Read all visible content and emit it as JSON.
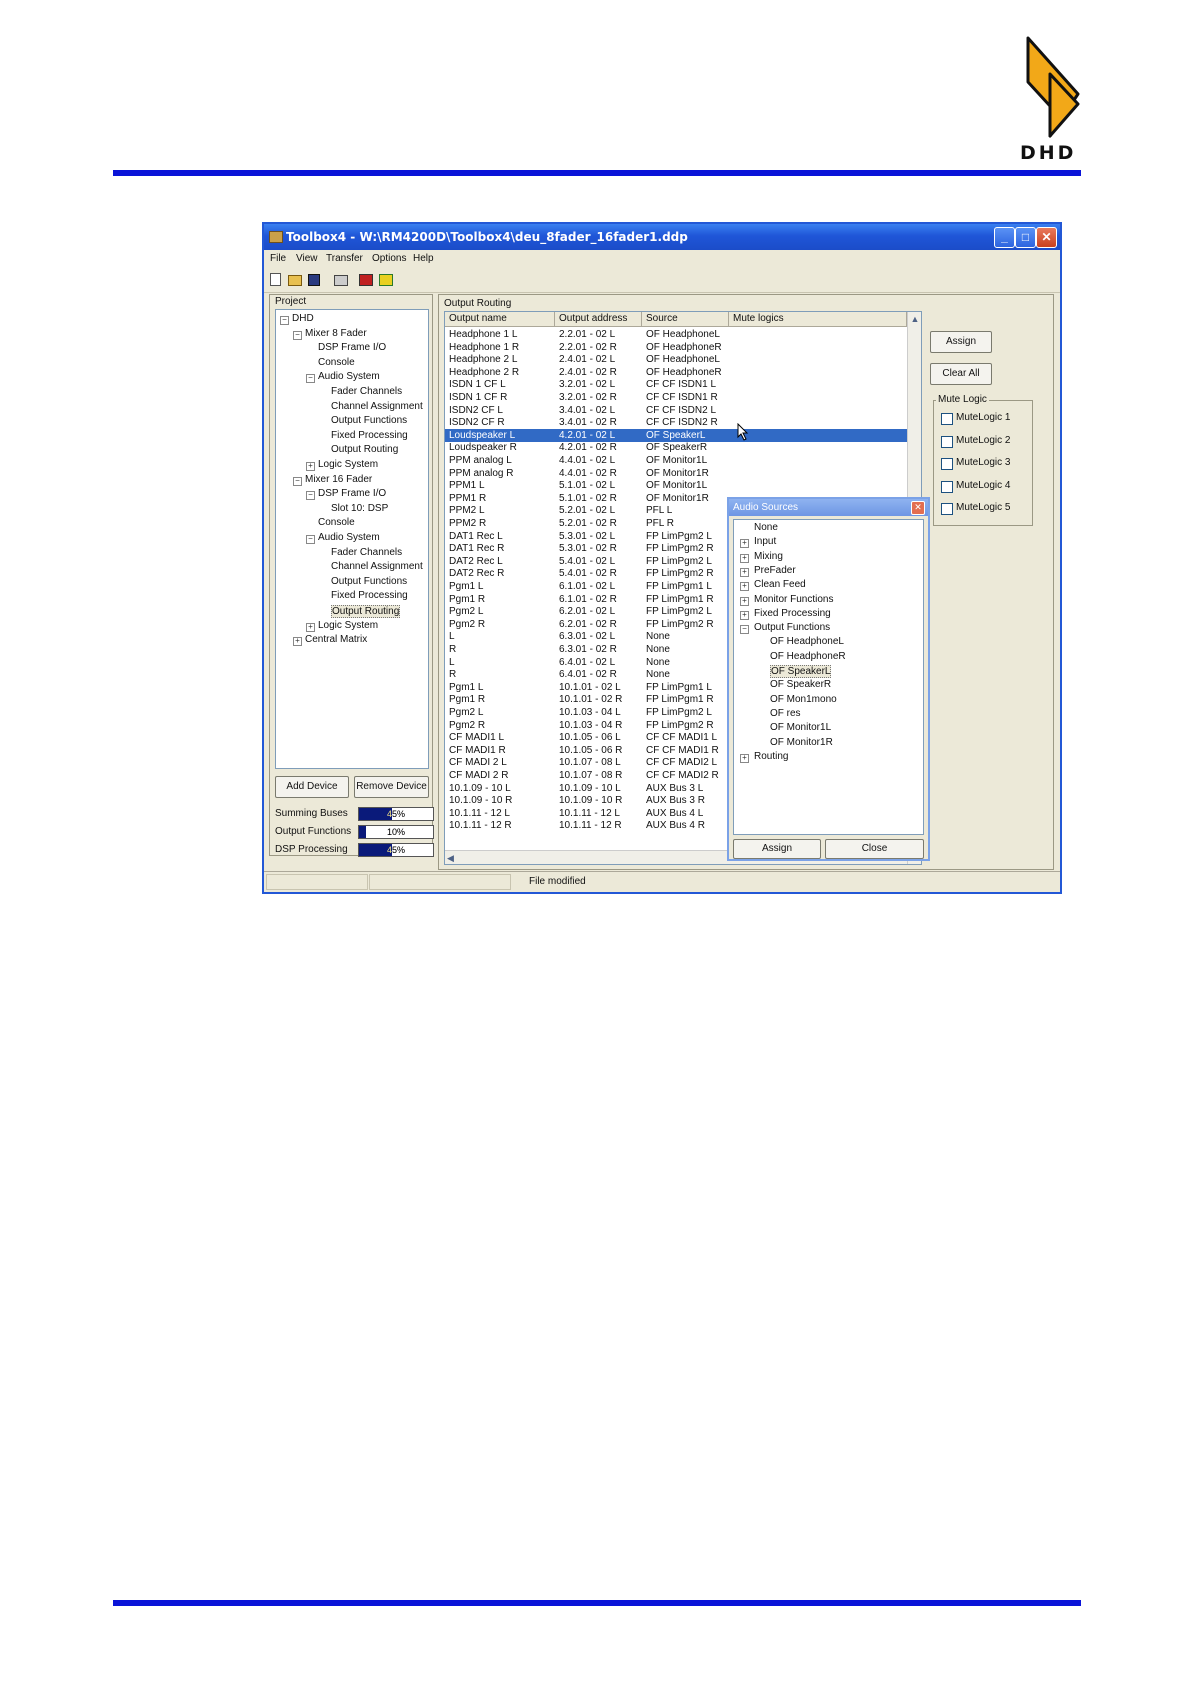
{
  "logo": {
    "text": "DHD"
  },
  "window": {
    "title": "Toolbox4 - W:\\RM4200D\\Toolbox4\\deu_8fader_16fader1.ddp",
    "menu": [
      "File",
      "View",
      "Transfer",
      "Options",
      "Help"
    ],
    "status_text": "File modified"
  },
  "project": {
    "label": "Project",
    "tree": [
      {
        "text": "DHD",
        "level": 0,
        "exp": "-"
      },
      {
        "text": "Mixer 8 Fader",
        "level": 1,
        "exp": "-"
      },
      {
        "text": "DSP Frame I/O",
        "level": 2,
        "exp": ""
      },
      {
        "text": "Console",
        "level": 2,
        "exp": ""
      },
      {
        "text": "Audio System",
        "level": 2,
        "exp": "-"
      },
      {
        "text": "Fader Channels",
        "level": 3,
        "exp": ""
      },
      {
        "text": "Channel Assignment",
        "level": 3,
        "exp": ""
      },
      {
        "text": "Output Functions",
        "level": 3,
        "exp": ""
      },
      {
        "text": "Fixed Processing",
        "level": 3,
        "exp": ""
      },
      {
        "text": "Output Routing",
        "level": 3,
        "exp": ""
      },
      {
        "text": "Logic System",
        "level": 2,
        "exp": "+"
      },
      {
        "text": "Mixer 16 Fader",
        "level": 1,
        "exp": "-"
      },
      {
        "text": "DSP Frame I/O",
        "level": 2,
        "exp": "-"
      },
      {
        "text": "Slot 10: DSP",
        "level": 3,
        "exp": ""
      },
      {
        "text": "Console",
        "level": 2,
        "exp": ""
      },
      {
        "text": "Audio System",
        "level": 2,
        "exp": "-"
      },
      {
        "text": "Fader Channels",
        "level": 3,
        "exp": ""
      },
      {
        "text": "Channel Assignment",
        "level": 3,
        "exp": ""
      },
      {
        "text": "Output Functions",
        "level": 3,
        "exp": ""
      },
      {
        "text": "Fixed Processing",
        "level": 3,
        "exp": ""
      },
      {
        "text": "Output Routing",
        "level": 3,
        "exp": "",
        "selected": true
      },
      {
        "text": "Logic System",
        "level": 2,
        "exp": "+"
      },
      {
        "text": "Central Matrix",
        "level": 1,
        "exp": "+"
      }
    ],
    "add_device": "Add Device",
    "remove_device": "Remove Device",
    "resources": [
      {
        "label": "Summing Buses",
        "percent": 45,
        "text": "45%"
      },
      {
        "label": "Output Functions",
        "percent": 10,
        "text": "10%"
      },
      {
        "label": "DSP Processing",
        "percent": 45,
        "text": "45%"
      }
    ]
  },
  "routing": {
    "label": "Output Routing",
    "columns": [
      "Output name",
      "Output address",
      "Source",
      "Mute logics"
    ],
    "selected_index": 8,
    "rows": [
      [
        "Headphone 1 L",
        "2.2.01 - 02 L",
        "OF HeadphoneL"
      ],
      [
        "Headphone 1 R",
        "2.2.01 - 02 R",
        "OF HeadphoneR"
      ],
      [
        "Headphone 2 L",
        "2.4.01 - 02 L",
        "OF HeadphoneL"
      ],
      [
        "Headphone 2 R",
        "2.4.01 - 02 R",
        "OF HeadphoneR"
      ],
      [
        "ISDN 1 CF L",
        "3.2.01 - 02 L",
        "CF CF ISDN1 L"
      ],
      [
        "ISDN 1 CF R",
        "3.2.01 - 02 R",
        "CF CF ISDN1 R"
      ],
      [
        "ISDN2 CF L",
        "3.4.01 - 02 L",
        "CF CF ISDN2 L"
      ],
      [
        "ISDN2 CF R",
        "3.4.01 - 02 R",
        "CF CF ISDN2 R"
      ],
      [
        "Loudspeaker L",
        "4.2.01 - 02 L",
        "OF SpeakerL"
      ],
      [
        "Loudspeaker R",
        "4.2.01 - 02 R",
        "OF SpeakerR"
      ],
      [
        "PPM analog L",
        "4.4.01 - 02 L",
        "OF Monitor1L"
      ],
      [
        "PPM analog R",
        "4.4.01 - 02 R",
        "OF Monitor1R"
      ],
      [
        "PPM1 L",
        "5.1.01 - 02 L",
        "OF Monitor1L"
      ],
      [
        "PPM1 R",
        "5.1.01 - 02 R",
        "OF Monitor1R"
      ],
      [
        "PPM2 L",
        "5.2.01 - 02 L",
        "PFL L"
      ],
      [
        "PPM2 R",
        "5.2.01 - 02 R",
        "PFL R"
      ],
      [
        "DAT1 Rec L",
        "5.3.01 - 02 L",
        "FP LimPgm2 L"
      ],
      [
        "DAT1 Rec R",
        "5.3.01 - 02 R",
        "FP LimPgm2 R"
      ],
      [
        "DAT2 Rec L",
        "5.4.01 - 02 L",
        "FP LimPgm2 L"
      ],
      [
        "DAT2 Rec R",
        "5.4.01 - 02 R",
        "FP LimPgm2 R"
      ],
      [
        "Pgm1 L",
        "6.1.01 - 02 L",
        "FP LimPgm1 L"
      ],
      [
        "Pgm1 R",
        "6.1.01 - 02 R",
        "FP LimPgm1 R"
      ],
      [
        "Pgm2 L",
        "6.2.01 - 02 L",
        "FP LimPgm2 L"
      ],
      [
        "Pgm2 R",
        "6.2.01 - 02 R",
        "FP LimPgm2 R"
      ],
      [
        "L",
        "6.3.01 - 02 L",
        "None"
      ],
      [
        "R",
        "6.3.01 - 02 R",
        "None"
      ],
      [
        "L",
        "6.4.01 - 02 L",
        "None"
      ],
      [
        "R",
        "6.4.01 - 02 R",
        "None"
      ],
      [
        "Pgm1 L",
        "10.1.01 - 02 L",
        "FP LimPgm1 L"
      ],
      [
        "Pgm1 R",
        "10.1.01 - 02 R",
        "FP LimPgm1 R"
      ],
      [
        "Pgm2 L",
        "10.1.03 - 04 L",
        "FP LimPgm2 L"
      ],
      [
        "Pgm2 R",
        "10.1.03 - 04 R",
        "FP LimPgm2 R"
      ],
      [
        "CF MADI1 L",
        "10.1.05 - 06 L",
        "CF CF MADI1 L"
      ],
      [
        "CF MADI1 R",
        "10.1.05 - 06 R",
        "CF CF MADI1 R"
      ],
      [
        "CF MADI 2 L",
        "10.1.07 - 08 L",
        "CF CF MADI2 L"
      ],
      [
        "CF MADI 2 R",
        "10.1.07 - 08 R",
        "CF CF MADI2 R"
      ],
      [
        "10.1.09 - 10 L",
        "10.1.09 - 10 L",
        "AUX Bus 3 L"
      ],
      [
        "10.1.09 - 10 R",
        "10.1.09 - 10 R",
        "AUX Bus 3 R"
      ],
      [
        "10.1.11 - 12 L",
        "10.1.11 - 12 L",
        "AUX Bus 4 L"
      ],
      [
        "10.1.11 - 12 R",
        "10.1.11 - 12 R",
        "AUX Bus 4 R"
      ]
    ]
  },
  "side": {
    "assign": "Assign",
    "clear_all": "Clear All",
    "mute_logic_label": "Mute Logic",
    "mute_logics": [
      "MuteLogic 1",
      "MuteLogic 2",
      "MuteLogic 3",
      "MuteLogic 4",
      "MuteLogic 5"
    ]
  },
  "audio_sources": {
    "title": "Audio Sources",
    "items": [
      {
        "text": "None",
        "level": 0,
        "exp": ""
      },
      {
        "text": "Input",
        "level": 0,
        "exp": "+"
      },
      {
        "text": "Mixing",
        "level": 0,
        "exp": "+"
      },
      {
        "text": "PreFader",
        "level": 0,
        "exp": "+"
      },
      {
        "text": "Clean Feed",
        "level": 0,
        "exp": "+"
      },
      {
        "text": "Monitor Functions",
        "level": 0,
        "exp": "+"
      },
      {
        "text": "Fixed Processing",
        "level": 0,
        "exp": "+"
      },
      {
        "text": "Output Functions",
        "level": 0,
        "exp": "-"
      },
      {
        "text": "OF HeadphoneL",
        "level": 1,
        "exp": ""
      },
      {
        "text": "OF HeadphoneR",
        "level": 1,
        "exp": ""
      },
      {
        "text": "OF SpeakerL",
        "level": 1,
        "exp": "",
        "selected": true
      },
      {
        "text": "OF SpeakerR",
        "level": 1,
        "exp": ""
      },
      {
        "text": "OF Mon1mono",
        "level": 1,
        "exp": ""
      },
      {
        "text": "OF res",
        "level": 1,
        "exp": ""
      },
      {
        "text": "OF Monitor1L",
        "level": 1,
        "exp": ""
      },
      {
        "text": "OF Monitor1R",
        "level": 1,
        "exp": ""
      },
      {
        "text": "Routing",
        "level": 0,
        "exp": "+"
      }
    ],
    "assign": "Assign",
    "close": "Close"
  }
}
